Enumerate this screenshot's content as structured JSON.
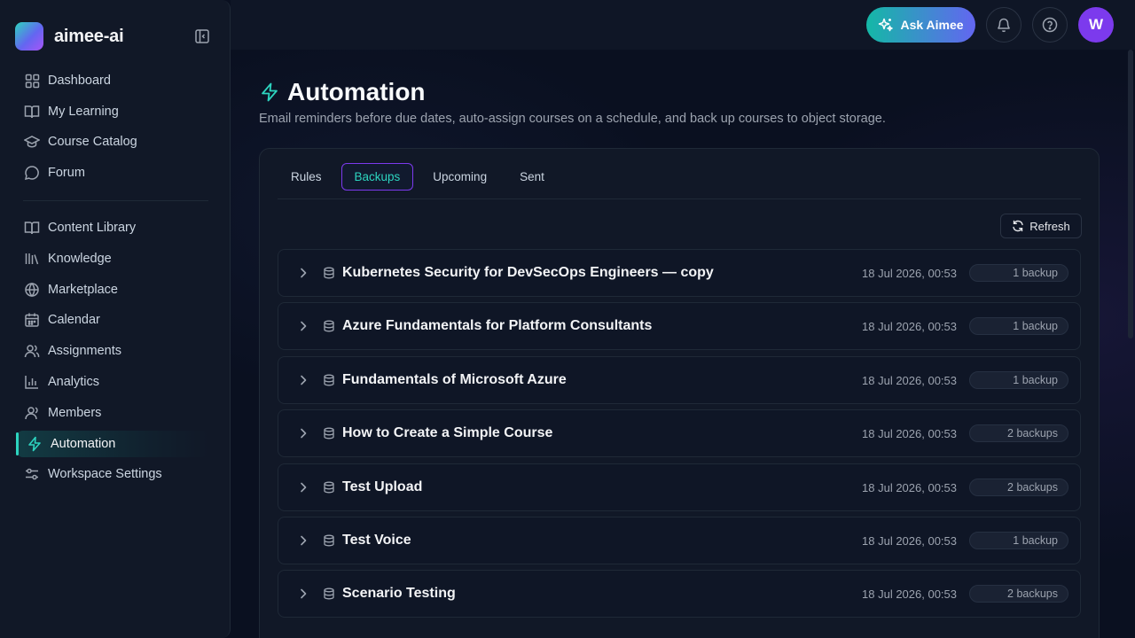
{
  "brand": {
    "name": "aimee-ai"
  },
  "sidebar": {
    "primary": [
      {
        "label": "Dashboard",
        "icon": "grid-icon"
      },
      {
        "label": "My Learning",
        "icon": "book-open-icon"
      },
      {
        "label": "Course Catalog",
        "icon": "graduation-cap-icon"
      },
      {
        "label": "Forum",
        "icon": "chat-bubble-icon"
      }
    ],
    "secondary": [
      {
        "label": "Content Library",
        "icon": "book-open-icon"
      },
      {
        "label": "Knowledge",
        "icon": "library-icon"
      },
      {
        "label": "Marketplace",
        "icon": "globe-icon"
      },
      {
        "label": "Calendar",
        "icon": "calendar-icon"
      },
      {
        "label": "Assignments",
        "icon": "users-icon"
      },
      {
        "label": "Analytics",
        "icon": "bar-chart-icon"
      },
      {
        "label": "Members",
        "icon": "user-icon"
      },
      {
        "label": "Automation",
        "icon": "lightning-icon",
        "active": true
      },
      {
        "label": "Workspace Settings",
        "icon": "sliders-icon"
      }
    ]
  },
  "topbar": {
    "ask_label": "Ask Aimee",
    "avatar_initial": "W"
  },
  "page": {
    "title": "Automation",
    "description": "Email reminders before due dates, auto-assign courses on a schedule, and back up courses to object storage."
  },
  "tabs": [
    {
      "label": "Rules"
    },
    {
      "label": "Backups",
      "active": true
    },
    {
      "label": "Upcoming"
    },
    {
      "label": "Sent"
    }
  ],
  "refresh_label": "Refresh",
  "backups": [
    {
      "name": "Kubernetes Security for DevSecOps Engineers — copy",
      "date": "18 Jul 2026, 00:53",
      "count": "1 backup"
    },
    {
      "name": "Azure Fundamentals for Platform Consultants",
      "date": "18 Jul 2026, 00:53",
      "count": "1 backup"
    },
    {
      "name": "Fundamentals of Microsoft Azure",
      "date": "18 Jul 2026, 00:53",
      "count": "1 backup"
    },
    {
      "name": "How to Create a Simple Course",
      "date": "18 Jul 2026, 00:53",
      "count": "2 backups"
    },
    {
      "name": "Test Upload",
      "date": "18 Jul 2026, 00:53",
      "count": "2 backups"
    },
    {
      "name": "Test Voice",
      "date": "18 Jul 2026, 00:53",
      "count": "1 backup"
    },
    {
      "name": "Scenario Testing",
      "date": "18 Jul 2026, 00:53",
      "count": "2 backups"
    }
  ],
  "colors": {
    "accent": "#2dd4bf",
    "accent_purple": "#7c3aed",
    "background": "#0b1120",
    "panel": "#111827"
  }
}
